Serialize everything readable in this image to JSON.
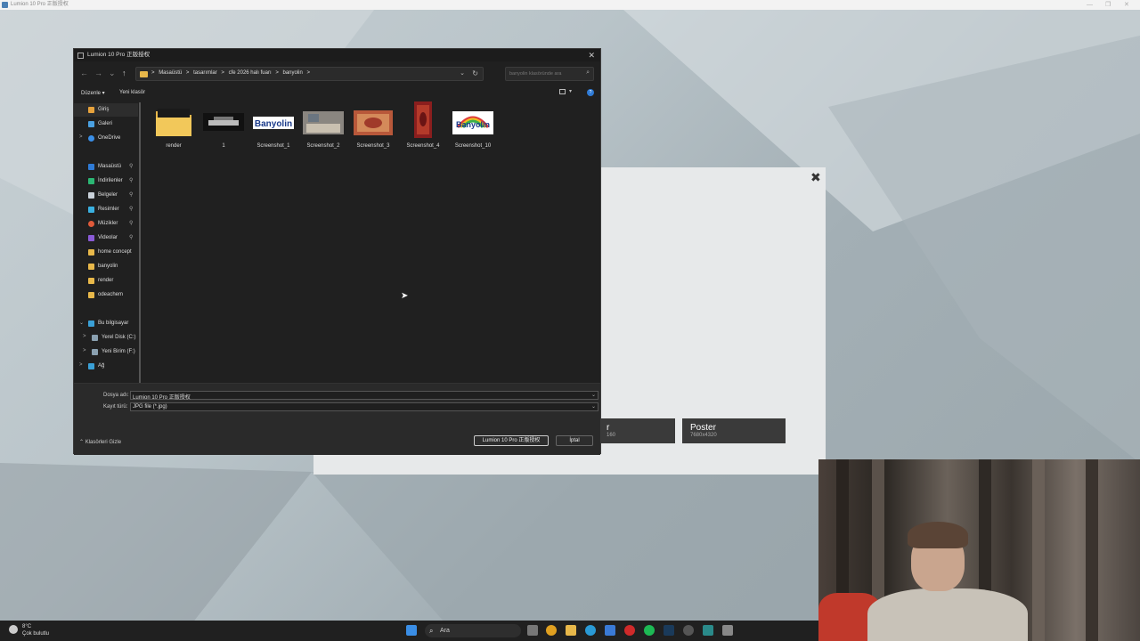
{
  "app": {
    "title": "Lumion 10 Pro 正版授权"
  },
  "lumion_panel": {
    "close": "✖",
    "buttons": [
      {
        "name": "r",
        "res": "160"
      },
      {
        "name": "Poster",
        "res": "7680x4320"
      }
    ]
  },
  "dialog": {
    "title": "Lumion 10 Pro 正版授权",
    "close": "✕",
    "nav": {
      "back": "←",
      "forward": "→",
      "dropdown": "⌄",
      "up": "↑"
    },
    "breadcrumbs": [
      "Masaüstü",
      ">",
      "tasarımlar",
      ">",
      "cfe 2026 halı fuarı",
      ">",
      "banyolin",
      ">"
    ],
    "search_placeholder": "banyolin klasöründe ara",
    "toolbar": {
      "organize": "Düzenle ▾",
      "new_folder": "Yeni klasör"
    },
    "sidebar": [
      {
        "label": "Giriş",
        "icon": "home-icon",
        "selected": true
      },
      {
        "label": "Galeri",
        "icon": "gallery-icon"
      },
      {
        "label": "OneDrive",
        "icon": "cloud-icon",
        "chevron": ">"
      },
      {
        "label": "Masaüstü",
        "icon": "desktop-icon",
        "pin": "📌"
      },
      {
        "label": "İndirilenler",
        "icon": "download-icon",
        "pin": "📌"
      },
      {
        "label": "Belgeler",
        "icon": "documents-icon",
        "pin": "📌"
      },
      {
        "label": "Resimler",
        "icon": "pictures-icon",
        "pin": "📌"
      },
      {
        "label": "Müzikler",
        "icon": "music-icon",
        "pin": "📌"
      },
      {
        "label": "Videolar",
        "icon": "videos-icon",
        "pin": "📌"
      },
      {
        "label": "home concept",
        "icon": "folder-icon"
      },
      {
        "label": "banyolin",
        "icon": "folder-icon"
      },
      {
        "label": "render",
        "icon": "folder-icon"
      },
      {
        "label": "odeachem",
        "icon": "folder-icon"
      },
      {
        "label": "Bu bilgisayar",
        "icon": "computer-icon",
        "chevron": "⌄"
      },
      {
        "label": "Yerel Disk (C:)",
        "icon": "drive-icon",
        "chevron": ">"
      },
      {
        "label": "Yeni Birim (F:)",
        "icon": "drive-icon",
        "chevron": ">"
      },
      {
        "label": "Ağ",
        "icon": "network-icon",
        "chevron": ">"
      }
    ],
    "files": [
      {
        "label": "render",
        "kind": "folder"
      },
      {
        "label": "1",
        "kind": "image-dark"
      },
      {
        "label": "Screenshot_1",
        "kind": "logo",
        "logo_text": "Banyolin"
      },
      {
        "label": "Screenshot_2",
        "kind": "image-room"
      },
      {
        "label": "Screenshot_3",
        "kind": "image-rug"
      },
      {
        "label": "Screenshot_4",
        "kind": "image-runner"
      },
      {
        "label": "Screenshot_10",
        "kind": "logo-rainbow",
        "logo_text": "Banyolin"
      }
    ],
    "filename_label": "Dosya adı:",
    "filename_value": "Lumion 10 Pro 正版授权",
    "filetype_label": "Kayıt türü:",
    "filetype_value": "JPG file (*.jpg)",
    "hide_folders": "⌃ Klasörleri Gizle",
    "save_button": "Lumion 10 Pro 正版授权",
    "cancel_button": "İptal"
  },
  "taskbar": {
    "weather_temp": "8°C",
    "weather_desc": "Çok bulutlu",
    "search": "Ara"
  },
  "colors": {
    "accent": "#2f7bd6",
    "folder": "#e8b84a"
  }
}
